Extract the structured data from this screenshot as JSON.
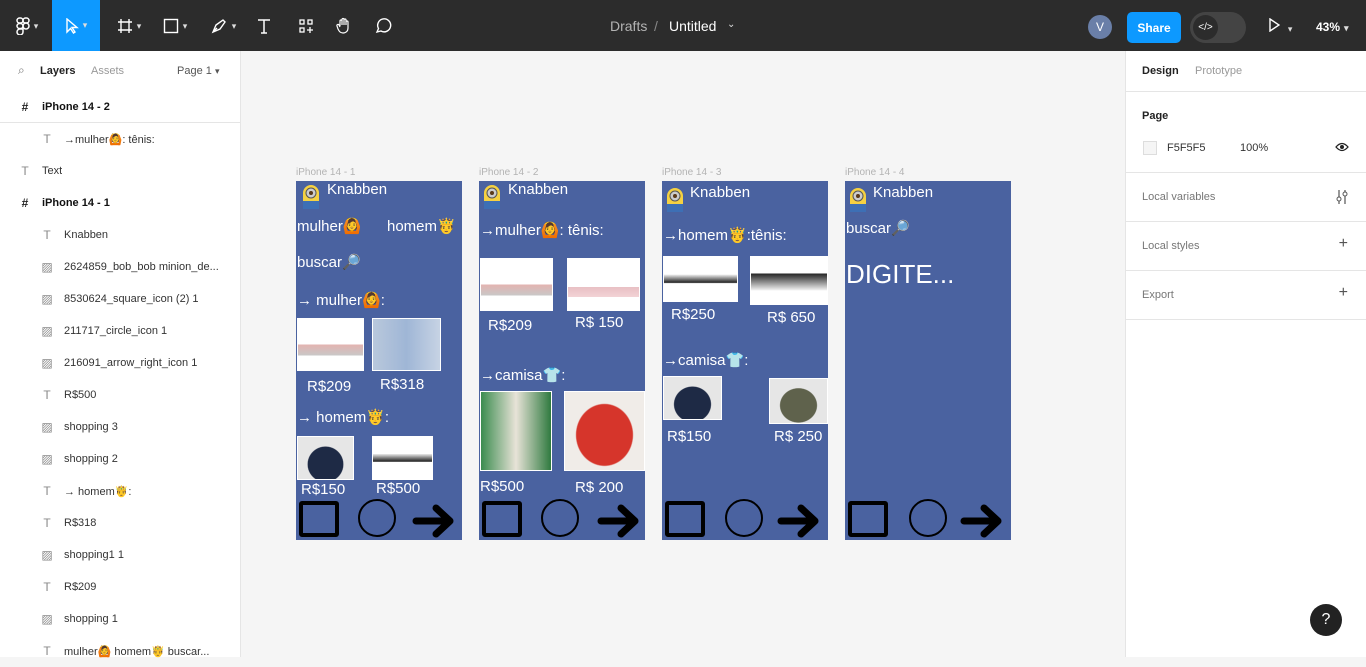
{
  "topbar": {
    "breadcrumb_drafts": "Drafts",
    "breadcrumb_sep": "/",
    "file_name": "Untitled",
    "avatar_initial": "V",
    "share_label": "Share",
    "zoom": "43%",
    "accent": "#0d99ff"
  },
  "left_panel": {
    "tab_layers": "Layers",
    "tab_assets": "Assets",
    "page_selector": "Page 1",
    "layers": [
      {
        "label": "iPhone 14 - 2",
        "type": "frame"
      },
      {
        "label": "→mulher🙆: tênis:",
        "type": "text"
      },
      {
        "label": "Text",
        "type": "text"
      },
      {
        "label": "iPhone 14 - 1",
        "type": "frame"
      },
      {
        "label": "Knabben",
        "type": "text"
      },
      {
        "label": "2624859_bob_bob minion_de...",
        "type": "image"
      },
      {
        "label": "8530624_square_icon (2) 1",
        "type": "image"
      },
      {
        "label": "211717_circle_icon 1",
        "type": "image"
      },
      {
        "label": "216091_arrow_right_icon 1",
        "type": "image"
      },
      {
        "label": "R$500",
        "type": "text"
      },
      {
        "label": "shopping 3",
        "type": "image"
      },
      {
        "label": "shopping 2",
        "type": "image"
      },
      {
        "label": "→ homem🤴:",
        "type": "text"
      },
      {
        "label": "R$318",
        "type": "text"
      },
      {
        "label": "shopping1 1",
        "type": "image"
      },
      {
        "label": "R$209",
        "type": "text"
      },
      {
        "label": "shopping 1",
        "type": "image"
      },
      {
        "label": "mulher🙆 homem🤴 buscar...",
        "type": "text"
      }
    ]
  },
  "right_panel": {
    "tab_design": "Design",
    "tab_prototype": "Prototype",
    "page_title": "Page",
    "page_color": "F5F5F5",
    "page_opacity": "100%",
    "local_variables": "Local variables",
    "local_styles": "Local styles",
    "export": "Export"
  },
  "canvas": {
    "frame_color": "#4a62a0",
    "frames": [
      {
        "label": "iPhone 14 - 1",
        "brand": "Knabben",
        "mulher": "mulher🙆",
        "homem": "homem🤴",
        "buscar": "buscar🔎",
        "sec1": "→ mulher🙆:",
        "price1": "R$209",
        "price2": "R$318",
        "sec2": "→ homem🤴:",
        "price3": "R$150",
        "price4": "R$500"
      },
      {
        "label": "iPhone 14 - 2",
        "brand": "Knabben",
        "sec1": "→mulher🙆: tênis:",
        "price1": "R$209",
        "price2": "R$ 150",
        "sec2": "→camisa👕:",
        "price3": "R$500",
        "price4": "R$ 200"
      },
      {
        "label": "iPhone 14 - 3",
        "brand": "Knabben",
        "sec1": "→homem🤴:tênis:",
        "price1": "R$250",
        "price2": "R$ 650",
        "sec2": "→camisa👕:",
        "price3": "R$150",
        "price4": "R$ 250"
      },
      {
        "label": "iPhone 14 - 4",
        "brand": "Knabben",
        "buscar": "buscar🔎",
        "search": "DIGITE..."
      }
    ]
  },
  "help_label": "?"
}
